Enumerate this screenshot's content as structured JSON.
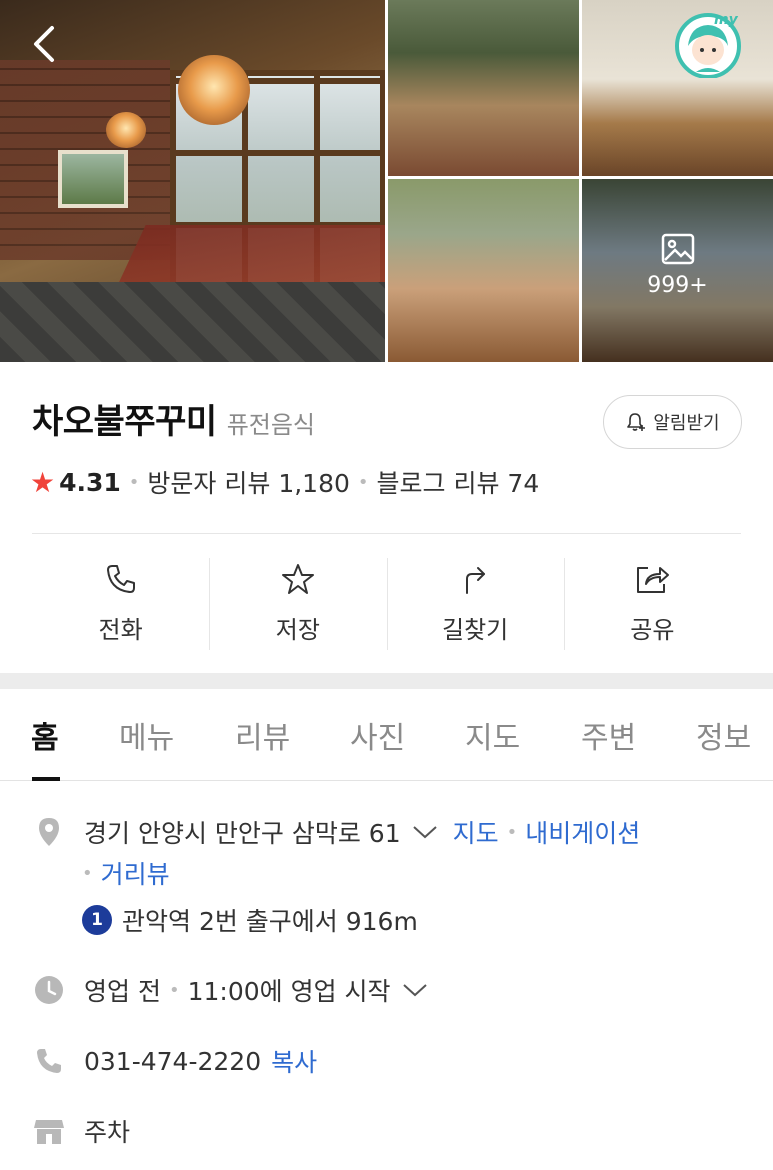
{
  "gallery": {
    "photo_count": "999+"
  },
  "place": {
    "name": "차오불쭈꾸미",
    "category": "퓨전음식",
    "alarm_label": "알림받기"
  },
  "rating": {
    "score": "4.31",
    "visitor_reviews": "방문자 리뷰 1,180",
    "blog_reviews": "블로그 리뷰 74"
  },
  "actions": [
    {
      "label": "전화",
      "icon": "phone-icon"
    },
    {
      "label": "저장",
      "icon": "star-outline-icon"
    },
    {
      "label": "길찾기",
      "icon": "directions-icon"
    },
    {
      "label": "공유",
      "icon": "share-icon"
    }
  ],
  "tabs": [
    "홈",
    "메뉴",
    "리뷰",
    "사진",
    "지도",
    "주변",
    "정보"
  ],
  "active_tab": "홈",
  "details": {
    "address": "경기 안양시 만안구 삼막로 61",
    "map_link": "지도",
    "navigation_link": "내비게이션",
    "street_view_link": "거리뷰",
    "subway_line": "1",
    "subway_info": "관악역 2번 출구에서 916m",
    "hours_status": "영업 전",
    "hours_detail": "11:00에 영업 시작",
    "phone": "031-474-2220",
    "copy_link": "복사",
    "parking": "주차"
  },
  "colors": {
    "accent_link": "#2f6bd0",
    "star": "#f0433a",
    "subway_line_1": "#1d3c9a",
    "profile_badge": "#3fc0b0"
  }
}
